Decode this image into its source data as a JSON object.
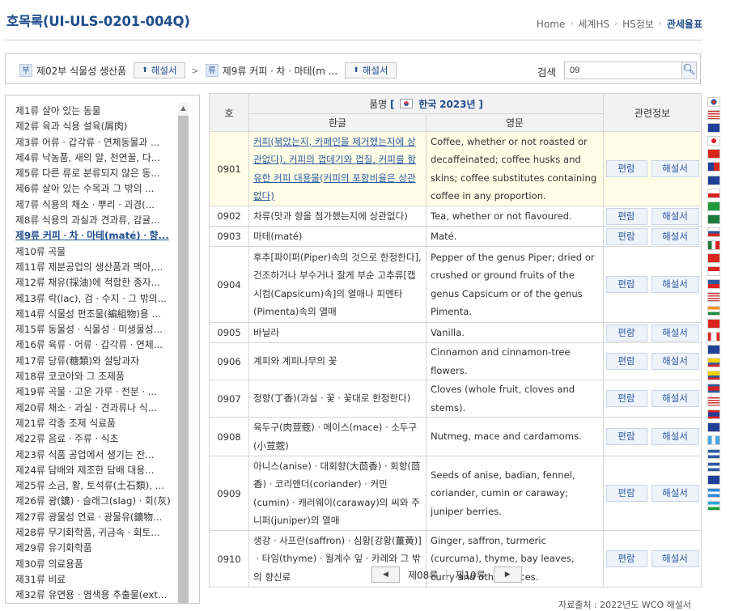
{
  "header": {
    "title": "호목록(UI-ULS-0201-004Q)",
    "breadcrumb": [
      "Home",
      "세계HS",
      "HS정보",
      "관세율표"
    ]
  },
  "nav": {
    "section_tag": "부",
    "section_label": "제02부 식물성 생산품",
    "chapter_tag": "류",
    "chapter_label": "제9류 커피ㆍ차ㆍ마테(m ...",
    "explain_label": "해설서",
    "search_label": "검색",
    "search_value": "09"
  },
  "sidebar": {
    "items": [
      "제1류 살아 있는 동물",
      "제2류 육과 식용 설육(屑肉)",
      "제3류 어류ㆍ갑각류ㆍ연체동물과 ...",
      "제4류 낙농품, 새의 알, 천연꿀, 다...",
      "제5류 다른 류로 분류되지 않은 동...",
      "제6류 살아 있는 수목과 그 밖의 ...",
      "제7류 식용의 채소ㆍ뿌리ㆍ괴경(...",
      "제8류 식용의 과실과 견과류, 감귤...",
      "제9류 커피ㆍ차ㆍ마테(maté)ㆍ향...",
      "제10류 곡물",
      "제11류 제분공업의 생산품과 맥아,...",
      "제12류 채유(採油)에 적합한 종자...",
      "제13류 락(lac), 검ㆍ수지ㆍ그 밖의...",
      "제14류 식물성 편조물(編組物)용 ...",
      "제15류 동물성ㆍ식물성ㆍ미생물성...",
      "제16류 육류ㆍ어류ㆍ갑각류ㆍ연체...",
      "제17류 당류(糖類)와 설탕과자",
      "제18류 코코아와 그 조제품",
      "제19류 곡물ㆍ고운 가루ㆍ전분ㆍ...",
      "제20류 채소ㆍ과실ㆍ견과류나 식...",
      "제21류 각종 조제 식료품",
      "제22류 음료ㆍ주류ㆍ식초",
      "제23류 식품 공업에서 생기는 잔...",
      "제24류 담배와 제조한 담배 대용...",
      "제25류 소금, 황, 토석류(土石類), ...",
      "제26류 광(鑛)ㆍ슬래그(slag)ㆍ회(灰)",
      "제27류 광물성 연료ㆍ광물유(鑛物...",
      "제28류 무기화학품, 귀금속ㆍ회토...",
      "제29류 유기화학품",
      "제30류 의료용품",
      "제31류 비료",
      "제32류 유연용ㆍ염색용 추출물(ext..."
    ],
    "active_index": 8
  },
  "table": {
    "col_code": "호",
    "col_name_prefix": "품명",
    "col_name_country": "한국",
    "col_name_year": "2023년",
    "col_ko": "한글",
    "col_en": "영문",
    "col_info": "관련정보",
    "btn_edit": "편람",
    "btn_explain": "해설서",
    "rows": [
      {
        "code": "0901",
        "ko": "커피(볶았는지, 카페인을 제거했는지에 상관없다), 커피의 껍데기와 껍질, 커피를 함유한 커피 대용물(커피의 포함비율은 상관없다)",
        "en": "Coffee, whether or not roasted or decaffeinated; coffee husks and skins; coffee substitutes containing coffee in any proportion."
      },
      {
        "code": "0902",
        "ko": "차류(맛과 향을 첨가했는지에 상관없다)",
        "en": "Tea, whether or not flavoured."
      },
      {
        "code": "0903",
        "ko": "마테(maté)",
        "en": "Maté."
      },
      {
        "code": "0904",
        "ko": "후추[파이퍼(Piper)속의 것으로 한정한다], 건조하거나 부수거나 잘게 부순 고추류[캡시컴(Capsicum)속]의 열매나 피멘타(Pimenta)속의 열매",
        "en": "Pepper of the genus Piper; dried or crushed or ground fruits of the genus Capsicum or of the genus Pimenta."
      },
      {
        "code": "0905",
        "ko": "바닐라",
        "en": "Vanilla."
      },
      {
        "code": "0906",
        "ko": "계피와 계피나무의 꽃",
        "en": "Cinnamon and cinnamon-tree flowers."
      },
      {
        "code": "0907",
        "ko": "정향(丁香)(과실ㆍ꽃ㆍ꽃대로 한정한다)",
        "en": "Cloves (whole fruit, cloves and stems)."
      },
      {
        "code": "0908",
        "ko": "육두구(肉荳蔲)ㆍ메이스(mace)ㆍ소두구(小荳蔲)",
        "en": "Nutmeg, mace and cardamoms."
      },
      {
        "code": "0909",
        "ko": "아니스(anise)ㆍ대회향(大茴香)ㆍ회향(茴香)ㆍ코리앤더(coriander)ㆍ커민(cumin)ㆍ캐러웨이(caraway)의 씨와 주니퍼(juniper)의 열매",
        "en": "Seeds of anise, badian, fennel, coriander, cumin or caraway; juniper berries."
      },
      {
        "code": "0910",
        "ko": "생강ㆍ사프란(saffron)ㆍ심황[강황(薑黃)]ㆍ타임(thyme)ㆍ월계수 잎ㆍ카레와 그 밖의 향신료",
        "en": "Ginger, saffron, turmeric (curcuma), thyme, bay leaves, curry and other spices."
      }
    ]
  },
  "pager": {
    "prev_label": "제08류",
    "next_label": "제10류"
  },
  "footnote": "자료출처 : 2022년도 WCO 해설서",
  "flags": [
    "kr",
    "us",
    "eu",
    "jp",
    "cn",
    "tw",
    "au",
    "cl",
    "br",
    "sa",
    "ru",
    "mx",
    "vn",
    "sg",
    "ph",
    "us2",
    "in",
    "ch",
    "ca",
    "nz",
    "co",
    "ec",
    "kh",
    "my",
    "la",
    "is",
    "gt",
    "hn",
    "sv",
    "gb",
    "ni",
    "uz"
  ],
  "colors": {
    "accent": "#1f4e8c",
    "link": "#2c5aa0",
    "highlight": "#fffde6"
  }
}
